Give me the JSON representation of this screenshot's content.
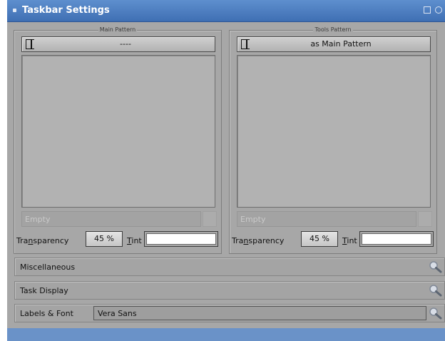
{
  "window": {
    "title": "Taskbar Settings"
  },
  "main_pattern": {
    "group_title": "Main Pattern",
    "button_label": "----",
    "empty_field": "Empty",
    "transparency_pre": "Tra",
    "transparency_mnemonic": "n",
    "transparency_post": "sparency",
    "transparency_value": "45 %",
    "tint_mnemonic": "T",
    "tint_post": "int",
    "tint_color": "#ffffff"
  },
  "tools_pattern": {
    "group_title": "Tools Pattern",
    "button_label": "as Main Pattern",
    "empty_field": "Empty",
    "transparency_pre": "Tra",
    "transparency_mnemonic": "n",
    "transparency_post": "sparency",
    "transparency_value": "45 %",
    "tint_mnemonic": "T",
    "tint_post": "int",
    "tint_color": "#ffffff"
  },
  "sections": {
    "miscellaneous": "Miscellaneous",
    "task_display": "Task Display",
    "labels_font": "Labels & Font",
    "font_value": "Vera Sans"
  },
  "icons": {
    "pattern_button": "pattern-icon",
    "expand": "magnifier-icon"
  },
  "colors": {
    "titlebar": "#4a7cc1",
    "window_bg": "#a7a7a7"
  }
}
